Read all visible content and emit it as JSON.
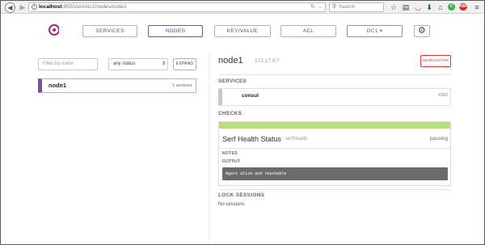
{
  "browser": {
    "url_host": "localhost",
    "url_path": ":8500/ui/#/dc1/nodes/node1",
    "search_placeholder": "Search"
  },
  "nav": {
    "services": "SERVICES",
    "nodes": "NODES",
    "kv": "KEY/VALUE",
    "acl": "ACL",
    "dc": "DC1 ▾",
    "active_tab": "NODES"
  },
  "filter": {
    "placeholder": "Filter by name",
    "status_value": "any status",
    "expand_label": "EXPAND"
  },
  "node_list": [
    {
      "name": "node1",
      "services": "1 services"
    }
  ],
  "node": {
    "name": "node1",
    "address": "172.17.0.7",
    "deregister_label": "DEREGISTER"
  },
  "services": {
    "heading": "SERVICES",
    "items": [
      {
        "name": "consul",
        "port": ":8300"
      }
    ]
  },
  "checks": {
    "heading": "CHECKS",
    "items": [
      {
        "name": "Serf Health Status",
        "id": "serfHealth",
        "status": "passing",
        "notes_label": "NOTES",
        "output_label": "OUTPUT",
        "output": "Agent alive and reachable"
      }
    ]
  },
  "lock_sessions": {
    "heading": "LOCK SESSIONS",
    "empty_text": "No sessions"
  },
  "colors": {
    "brand": "#9b2a71",
    "nodes_accent": "#7a4ea3",
    "dc_accent": "#6bb04a",
    "passing": "#b5e07a",
    "deregister": "#dd3333"
  }
}
